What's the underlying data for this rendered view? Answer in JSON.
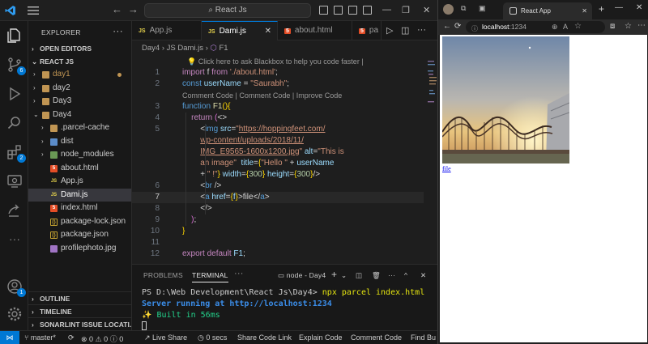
{
  "titlebar": {
    "search_text": "React Js",
    "back_icon": "arrow-left-icon",
    "forward_icon": "arrow-right-icon"
  },
  "activity_bar": {
    "items": [
      {
        "name": "explorer-icon"
      },
      {
        "name": "source-control-icon",
        "badge": "6"
      },
      {
        "name": "run-debug-icon"
      },
      {
        "name": "search-icon"
      },
      {
        "name": "extensions-icon",
        "badge": "2"
      },
      {
        "name": "remote-explorer-icon"
      },
      {
        "name": "live-share-icon"
      },
      {
        "name": "more-icon"
      }
    ],
    "account_badge": "1"
  },
  "sidebar": {
    "title": "EXPLORER",
    "more": "···",
    "open_editors": "OPEN EDITORS",
    "project": "REACT JS",
    "tree": [
      {
        "label": "day1",
        "kind": "folder",
        "depth": 0,
        "chev": "›",
        "color": "#c09553",
        "modified": true
      },
      {
        "label": "day2",
        "kind": "folder",
        "depth": 0,
        "chev": "›",
        "color": "#cccccc"
      },
      {
        "label": "Day3",
        "kind": "folder",
        "depth": 0,
        "chev": "›",
        "color": "#cccccc"
      },
      {
        "label": "Day4",
        "kind": "folder",
        "depth": 0,
        "chev": "⌄",
        "color": "#cccccc"
      },
      {
        "label": ".parcel-cache",
        "kind": "folder",
        "depth": 1,
        "chev": "›",
        "color": "#cccccc"
      },
      {
        "label": "dist",
        "kind": "folder-blue",
        "depth": 1,
        "chev": "›",
        "color": "#cccccc"
      },
      {
        "label": "node_modules",
        "kind": "folder-green",
        "depth": 1,
        "chev": "›",
        "color": "#cccccc"
      },
      {
        "label": "about.html",
        "kind": "html",
        "depth": 1,
        "color": "#cccccc"
      },
      {
        "label": "App.js",
        "kind": "js",
        "depth": 1,
        "color": "#cccccc"
      },
      {
        "label": "Dami.js",
        "kind": "js",
        "depth": 1,
        "color": "#ffffff",
        "active": true
      },
      {
        "label": "index.html",
        "kind": "html",
        "depth": 1,
        "color": "#cccccc"
      },
      {
        "label": "package-lock.json",
        "kind": "json",
        "depth": 1,
        "color": "#cccccc"
      },
      {
        "label": "package.json",
        "kind": "json",
        "depth": 1,
        "color": "#cccccc"
      },
      {
        "label": "profilephoto.jpg",
        "kind": "img",
        "depth": 1,
        "color": "#cccccc"
      }
    ],
    "outline": "OUTLINE",
    "timeline": "TIMELINE",
    "sonarlint": "SONARLINT ISSUE LOCATI..."
  },
  "editor": {
    "tabs": [
      {
        "label": "App.js",
        "icon": "JS",
        "active": false
      },
      {
        "label": "Dami.js",
        "icon": "JS",
        "active": true
      },
      {
        "label": "about.html",
        "icon": "html",
        "active": false
      },
      {
        "label": "pa",
        "icon": "html",
        "active": false
      }
    ],
    "breadcrumb": [
      "Day4",
      "JS Dami.js",
      "F1"
    ],
    "blackbox_hint": "💡 Click here to ask Blackbox to help you code faster |",
    "codelens": "Comment Code | Comment Code | Improve Code",
    "line_numbers": [
      "1",
      "2",
      "3",
      "4",
      "5",
      "6",
      "7",
      "8",
      "9",
      "10",
      "11",
      "12"
    ]
  },
  "panel": {
    "tabs": [
      "PROBLEMS",
      "TERMINAL"
    ],
    "active_tab": "TERMINAL",
    "more": "···",
    "terminal_name": "node - Day4",
    "prompt": "PS D:\\Web Development\\React Js\\Day4>",
    "command": "npx parcel index.html",
    "server_msg": "Server running at http://localhost:1234",
    "built_msg": "✨ Built in 56ms"
  },
  "statusbar": {
    "branch": "master*",
    "errors": "0",
    "warnings": "0",
    "info": "0",
    "live_share": "Live Share",
    "timer": "0 secs",
    "share_link": "Share Code Link",
    "explain": "Explain Code",
    "comment": "Comment Code",
    "find_bugs": "Find Bu"
  },
  "browser": {
    "tab_title": "React App",
    "url_host": "localhost",
    "url_port": ":1234",
    "link_text": "file"
  }
}
